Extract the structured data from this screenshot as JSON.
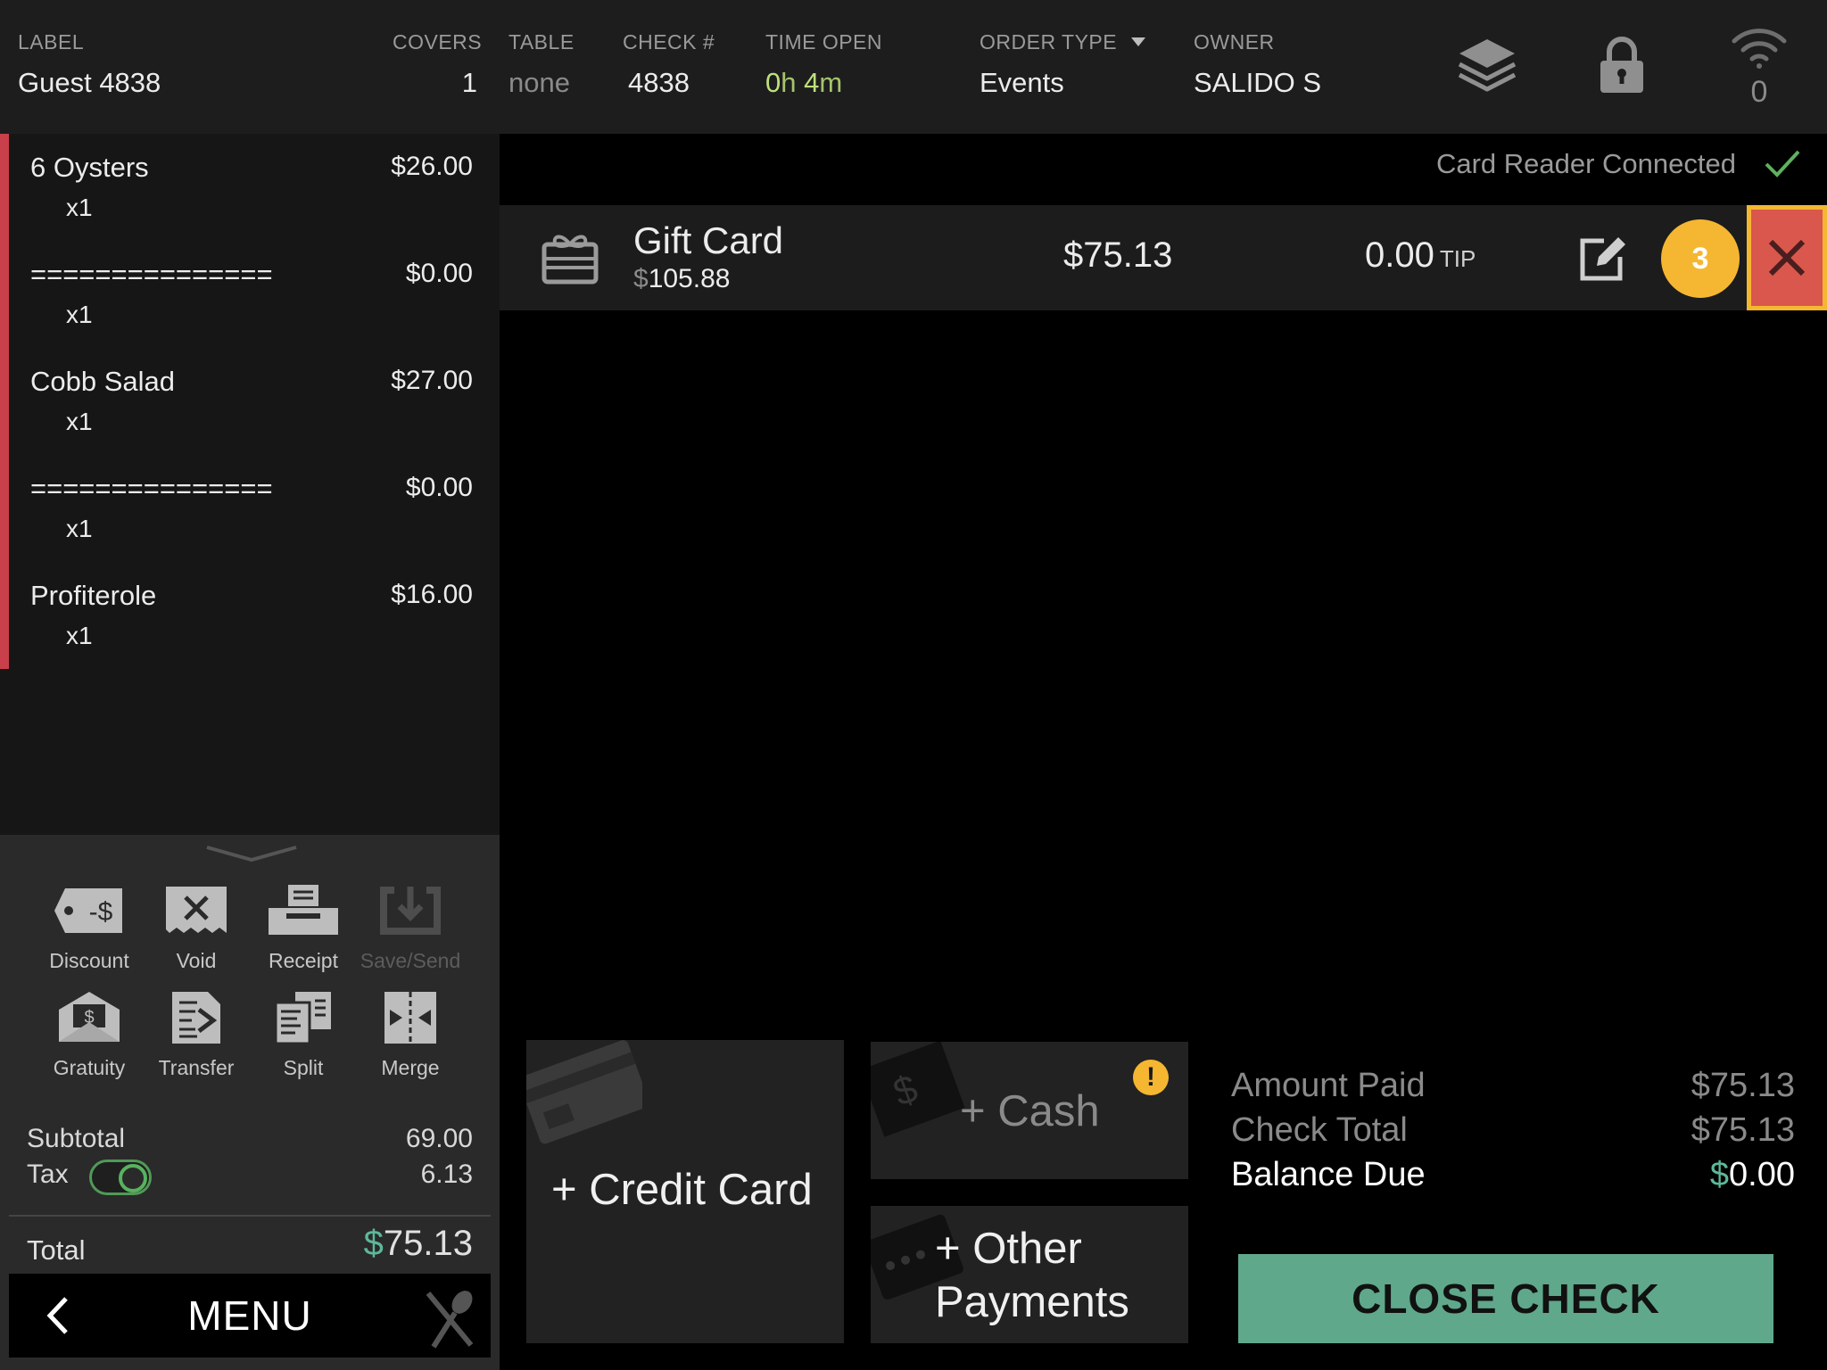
{
  "header": {
    "label_title": "LABEL",
    "label_value": "Guest 4838",
    "covers_title": "COVERS",
    "covers_value": "1",
    "table_title": "TABLE",
    "table_value": "none",
    "check_title": "CHECK #",
    "check_value": "4838",
    "time_title": "TIME OPEN",
    "time_h_num": "0",
    "time_h_unit": "h ",
    "time_m_num": "4",
    "time_m_unit": "m",
    "order_type_title": "ORDER TYPE",
    "order_type_value": "Events",
    "owner_title": "OWNER",
    "owner_value": "SALIDO S",
    "wifi_count": "0",
    "icons": [
      "layers-icon",
      "lock-icon",
      "wifi-icon"
    ]
  },
  "order_items": [
    {
      "name": "6 Oysters",
      "price": "$26.00",
      "qty": "x1"
    },
    {
      "name": "===============",
      "price": "$0.00",
      "qty": "x1"
    },
    {
      "name": "Cobb Salad",
      "price": "$27.00",
      "qty": "x1"
    },
    {
      "name": "===============",
      "price": "$0.00",
      "qty": "x1"
    },
    {
      "name": "Profiterole",
      "price": "$16.00",
      "qty": "x1"
    }
  ],
  "tools": [
    {
      "label": "Discount",
      "icon": "discount-tag-icon",
      "enabled": true
    },
    {
      "label": "Void",
      "icon": "void-receipt-icon",
      "enabled": true
    },
    {
      "label": "Receipt",
      "icon": "printer-icon",
      "enabled": true
    },
    {
      "label": "Save/Send",
      "icon": "save-send-icon",
      "enabled": false
    },
    {
      "label": "Gratuity",
      "icon": "gratuity-envelope-icon",
      "enabled": true
    },
    {
      "label": "Transfer",
      "icon": "transfer-doc-icon",
      "enabled": true
    },
    {
      "label": "Split",
      "icon": "split-docs-icon",
      "enabled": true
    },
    {
      "label": "Merge",
      "icon": "merge-icon",
      "enabled": true
    }
  ],
  "summary": {
    "subtotal_label": "Subtotal",
    "subtotal_value": "69.00",
    "tax_label": "Tax",
    "tax_value": "6.13",
    "tax_enabled": true,
    "total_label": "Total",
    "total_currency": "$",
    "total_value": "75.13"
  },
  "menu_button": {
    "label": "MENU"
  },
  "card_reader": {
    "status": "Card Reader Connected"
  },
  "payment": {
    "type": "Gift Card",
    "balance_currency": "$",
    "balance_value": "105.88",
    "amount": "$75.13",
    "tip_value": "0.00",
    "tip_label": "TIP",
    "badge_number": "3"
  },
  "payment_buttons": {
    "credit_card": "+ Credit Card",
    "cash": "+ Cash",
    "other_line1": "+ Other",
    "other_line2": "Payments"
  },
  "totals": {
    "amount_paid_label": "Amount Paid",
    "amount_paid_value": "$75.13",
    "check_total_label": "Check Total",
    "check_total_value": "$75.13",
    "balance_due_label": "Balance Due",
    "balance_due_currency": "$",
    "balance_due_value": "0.00"
  },
  "close_check_label": "CLOSE CHECK",
  "colors": {
    "accent_red": "#c9404a",
    "badge_yellow": "#f5b731",
    "close_green": "#5fa88b",
    "currency_green": "#5db89a",
    "time_green": "#bde07c"
  }
}
